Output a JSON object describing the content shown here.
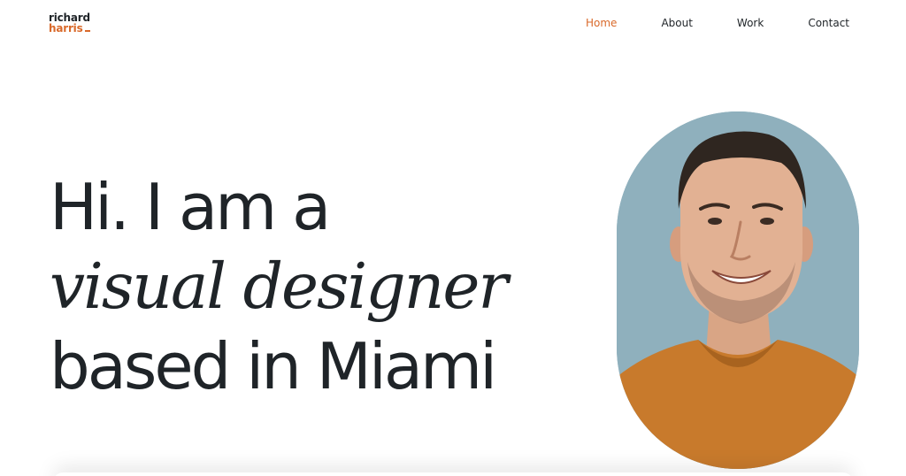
{
  "logo": {
    "first": "richard",
    "last": "harris"
  },
  "nav": {
    "items": [
      {
        "label": "Home",
        "active": true
      },
      {
        "label": "About",
        "active": false
      },
      {
        "label": "Work",
        "active": false
      },
      {
        "label": "Contact",
        "active": false
      }
    ]
  },
  "hero": {
    "line1": "Hi. I am a",
    "line2": "visual designer",
    "line3": "based in Miami"
  },
  "colors": {
    "accent": "#d9692a",
    "text": "#1f2428",
    "portrait_bg": "#8fb0bd",
    "shirt": "#c87a2c"
  },
  "portrait": {
    "icon": "profile-photo"
  }
}
